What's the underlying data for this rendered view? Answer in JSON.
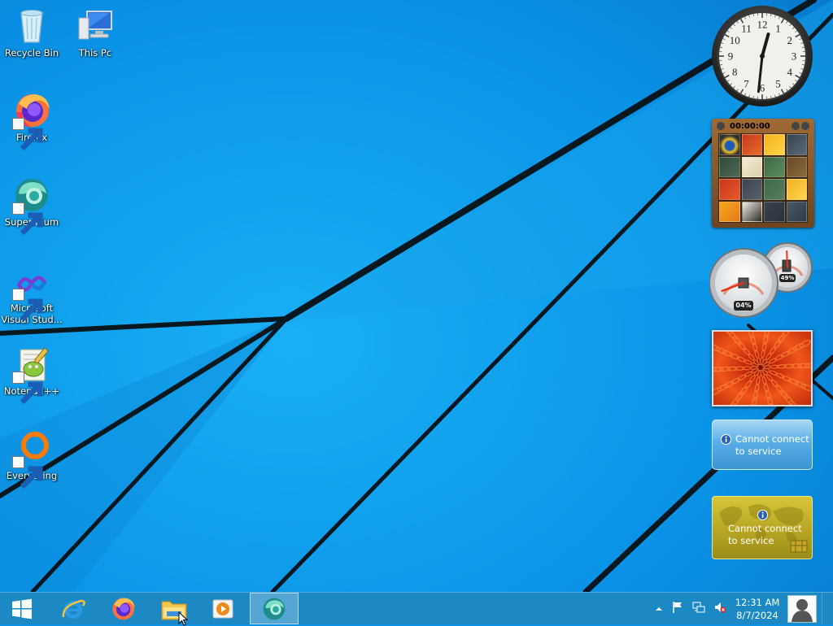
{
  "desktop": {
    "icons": [
      {
        "label": "Recycle Bin",
        "icon": "recycle-bin-icon"
      },
      {
        "label": "This Pc",
        "icon": "computer-icon"
      },
      {
        "label": "Firefox",
        "icon": "firefox-icon"
      },
      {
        "label": "Supermium",
        "icon": "supermium-icon"
      },
      {
        "label": "Microsoft Visual Stud...",
        "icon": "visual-studio-icon"
      },
      {
        "label": "Notepad++",
        "icon": "notepadpp-icon"
      },
      {
        "label": "Everything",
        "icon": "everything-icon"
      }
    ]
  },
  "gadgets": {
    "clock": {
      "numerals": [
        "12",
        "1",
        "2",
        "3",
        "4",
        "5",
        "6",
        "7",
        "8",
        "9",
        "10",
        "11"
      ],
      "hour": 0,
      "minute": 31
    },
    "puzzle": {
      "timer": "00:00:00"
    },
    "cpu_meter": {
      "cpu": "04%",
      "memory": "49%",
      "cpu_value": 4,
      "memory_value": 49
    },
    "currency": {
      "message_line1": "Cannot connect",
      "message_line2": "to service"
    },
    "weather": {
      "message_line1": "Cannot connect",
      "message_line2": "to service"
    }
  },
  "taskbar": {
    "pinned": [
      "start-button",
      "internet-explorer",
      "firefox",
      "file-explorer",
      "media-player",
      "supermium"
    ],
    "active": "supermium",
    "tray": {
      "time": "12:31 AM",
      "date": "8/7/2024"
    }
  },
  "colors": {
    "wallpaper": "#0a93e6",
    "taskbar": "#1c89c4",
    "puzzle_frame": "#8a5a2b",
    "service_gadget": "#5aaee6",
    "weather_gadget": "#b5a322"
  }
}
